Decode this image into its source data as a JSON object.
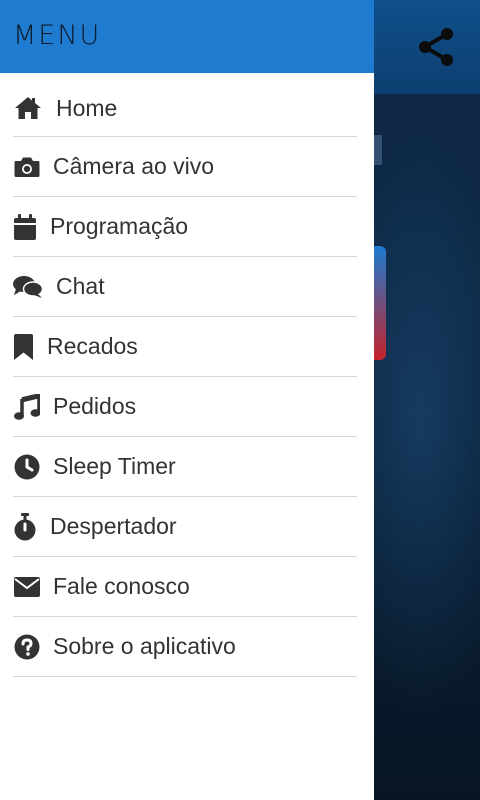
{
  "drawer": {
    "title": "MENU",
    "items": [
      {
        "label": "Home",
        "icon": "home-icon"
      },
      {
        "label": "Câmera ao vivo",
        "icon": "camera-icon"
      },
      {
        "label": "Programação",
        "icon": "calendar-icon"
      },
      {
        "label": "Chat",
        "icon": "chat-icon"
      },
      {
        "label": "Recados",
        "icon": "bookmark-icon"
      },
      {
        "label": "Pedidos",
        "icon": "music-icon"
      },
      {
        "label": "Sleep Timer",
        "icon": "clock-icon"
      },
      {
        "label": "Despertador",
        "icon": "stopwatch-icon"
      },
      {
        "label": "Fale conosco",
        "icon": "envelope-icon"
      },
      {
        "label": "Sobre o aplicativo",
        "icon": "question-circle-icon"
      }
    ]
  },
  "app": {
    "share_icon": "share-icon"
  },
  "colors": {
    "header": "#1e7bd0",
    "icon": "#333333",
    "text": "#333333",
    "divider": "#d6d6d6"
  }
}
